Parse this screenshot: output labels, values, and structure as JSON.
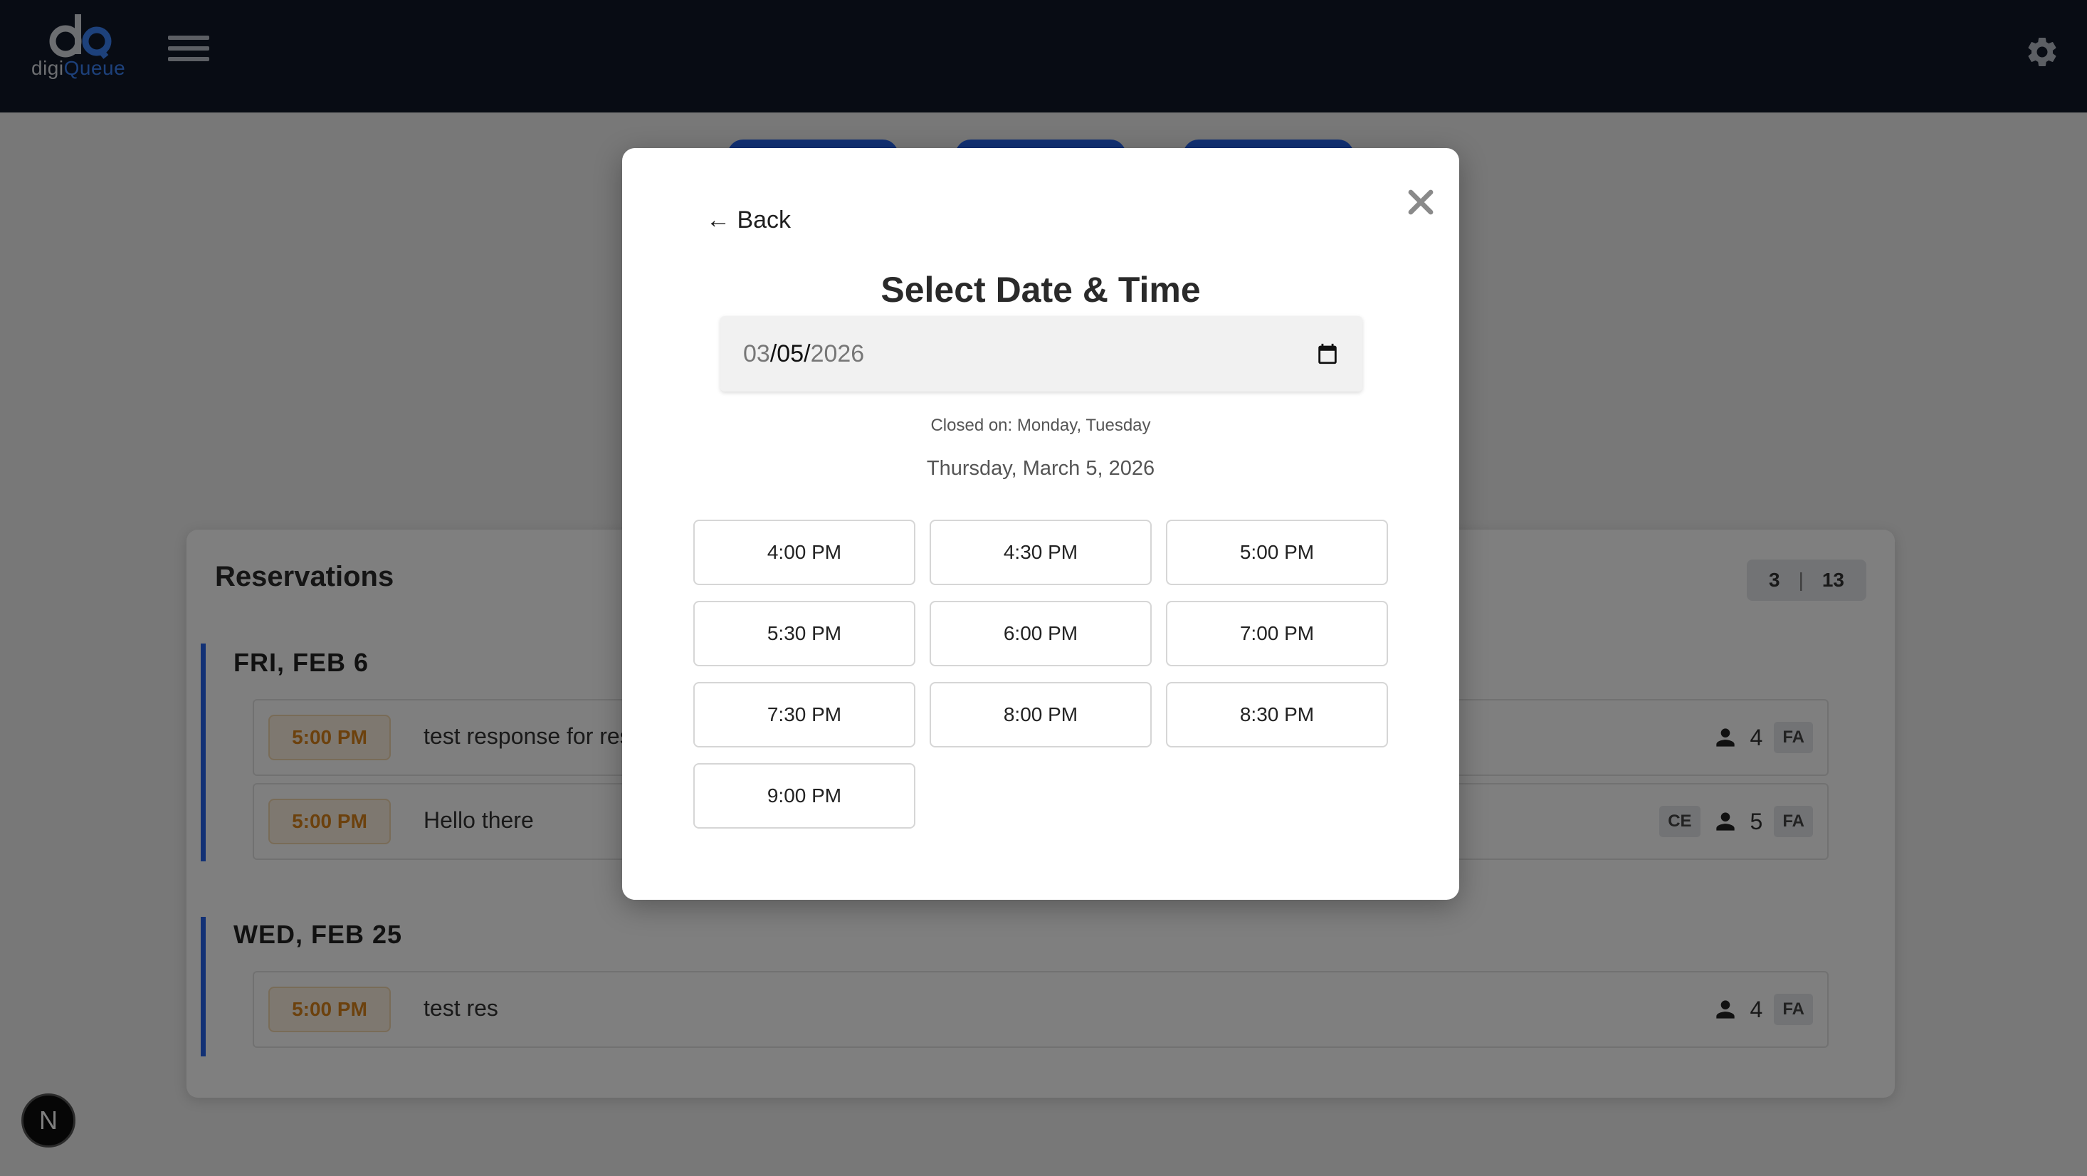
{
  "header": {
    "logo_text_primary": "digi",
    "logo_text_accent": "Queue",
    "brand_accent": "#3b82f6",
    "background": "#101828",
    "menu_icon": "hamburger-menu-icon",
    "settings_icon": "gear-icon"
  },
  "reservations": {
    "title": "Reservations",
    "count_left": "3",
    "count_separator": "|",
    "count_right": "13",
    "groups": [
      {
        "date": "FRI, FEB 6",
        "rows": [
          {
            "time": "5:00 PM",
            "name": "test response for res",
            "tag": "",
            "party": "4",
            "code": "FA"
          },
          {
            "time": "5:00 PM",
            "name": "Hello there",
            "tag": "CE",
            "party": "5",
            "code": "FA"
          }
        ]
      },
      {
        "date": "WED, FEB 25",
        "rows": [
          {
            "time": "5:00 PM",
            "name": "test res",
            "tag": "",
            "party": "4",
            "code": "FA"
          }
        ]
      }
    ]
  },
  "next_badge": "N",
  "modal": {
    "back_label": "← Back",
    "close_icon": "close-icon",
    "title": "Select Date & Time",
    "date_month": "03",
    "date_day": "05",
    "date_year": "2026",
    "date_sep": "/",
    "closed_note": "Closed on: Monday, Tuesday",
    "selected_date": "Thursday, March 5, 2026",
    "slots": [
      "4:00 PM",
      "4:30 PM",
      "5:00 PM",
      "5:30 PM",
      "6:00 PM",
      "7:00 PM",
      "7:30 PM",
      "8:00 PM",
      "8:30 PM",
      "9:00 PM"
    ]
  }
}
